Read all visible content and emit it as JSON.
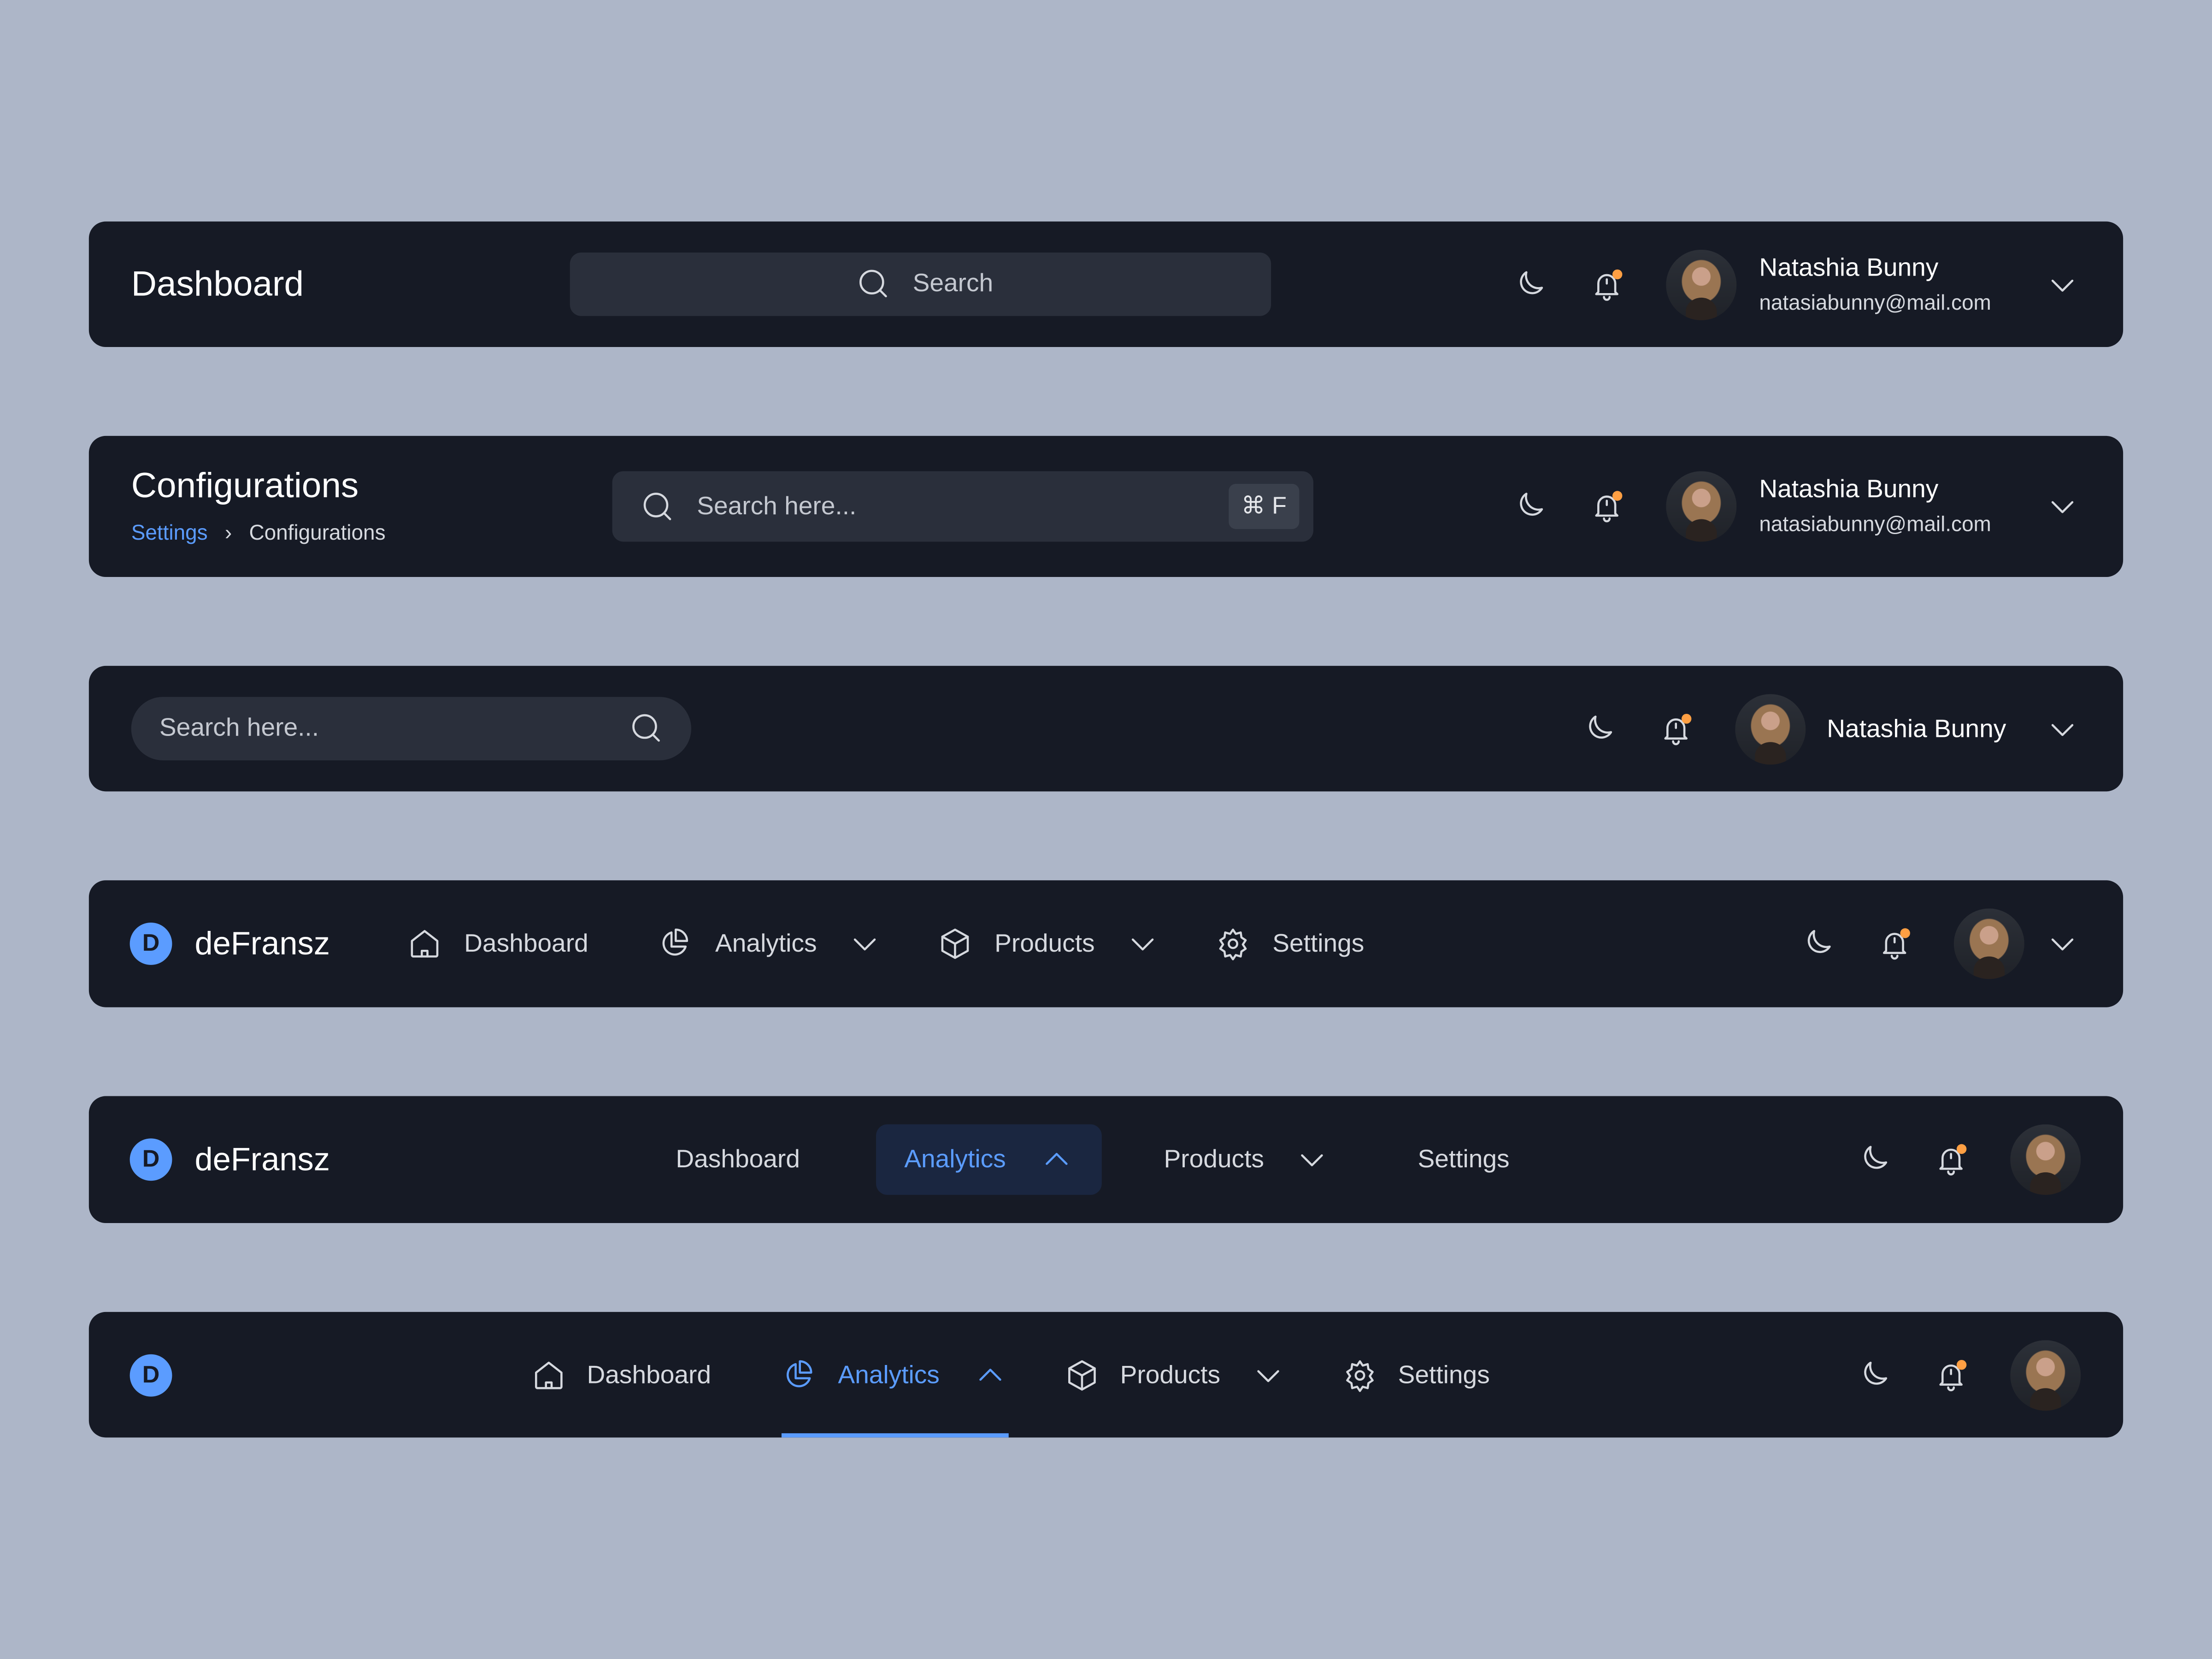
{
  "colors": {
    "background": "#adb6c8",
    "bar": "#161a25",
    "accent": "#5b9cff",
    "notification": "#ff9f43"
  },
  "user": {
    "name": "Natashia Bunny",
    "email": "natasiabunny@mail.com"
  },
  "header1": {
    "title": "Dashboard",
    "search_placeholder": "Search"
  },
  "header2": {
    "title": "Configurations",
    "breadcrumb": [
      "Settings",
      "Configurations"
    ],
    "breadcrumb_separator": "›",
    "search_placeholder": "Search here...",
    "shortcut": "⌘ F"
  },
  "header3": {
    "search_placeholder": "Search here..."
  },
  "brand": {
    "initial": "D",
    "name": "deFransz"
  },
  "nav": {
    "dashboard": "Dashboard",
    "analytics": "Analytics",
    "products": "Products",
    "settings": "Settings"
  },
  "icons": [
    "search-icon",
    "moon-icon",
    "bell-icon",
    "chevron-down-icon",
    "chevron-up-icon",
    "home-icon",
    "pie-chart-icon",
    "cube-icon",
    "gear-icon"
  ]
}
